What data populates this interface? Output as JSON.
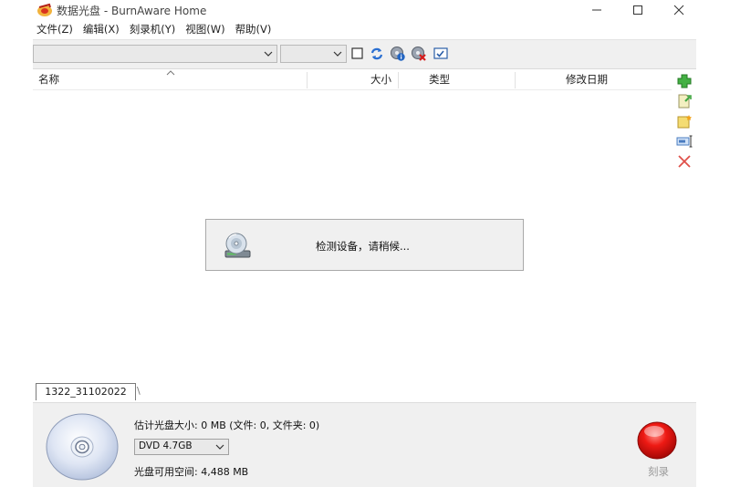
{
  "window": {
    "title": "数据光盘 - BurnAware Home"
  },
  "menu": {
    "items": [
      "文件(Z)",
      "编辑(X)",
      "刻录机(Y)",
      "视图(W)",
      "帮助(V)"
    ]
  },
  "toolbar": {
    "combo_path_value": "",
    "combo_filter_value": "",
    "icons": [
      "checkbox-icon",
      "refresh-icon",
      "info-icon",
      "erase-icon",
      "checklist-icon"
    ]
  },
  "list": {
    "columns": [
      "名称",
      "大小",
      "类型",
      "修改日期"
    ],
    "rows": []
  },
  "side_buttons": [
    "add-icon",
    "add-folder-icon",
    "new-folder-icon",
    "rename-icon",
    "delete-icon"
  ],
  "status": {
    "message": "检测设备，请稍候..."
  },
  "tabs": {
    "active": "1322_31102022",
    "separator": "\\"
  },
  "bottom": {
    "estimated_size": "估计光盘大小: 0 MB (文件: 0, 文件夹: 0)",
    "disc_type": "DVD 4.7GB",
    "free_space": "光盘可用空间: 4,488 MB",
    "burn_label": "刻录"
  },
  "colors": {
    "toolbar_bg": "#f0f0f0",
    "burn_button": "#e0191b",
    "add_green": "#3aa63a"
  }
}
